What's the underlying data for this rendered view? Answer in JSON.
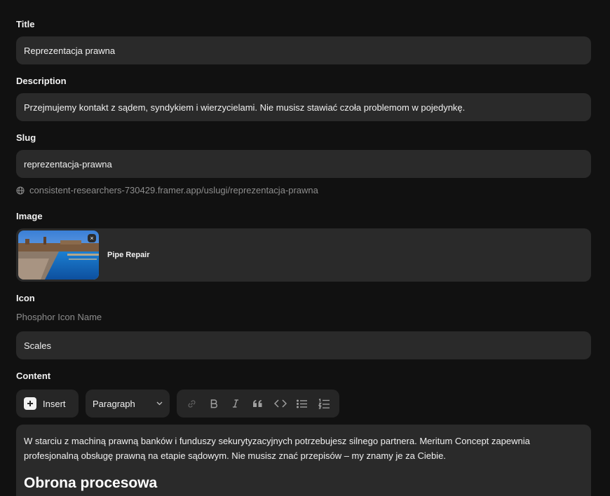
{
  "fields": {
    "title": {
      "label": "Title",
      "value": "Reprezentacja prawna"
    },
    "description": {
      "label": "Description",
      "value": "Przejmujemy kontakt z sądem, syndykiem i wierzycielami. Nie musisz stawiać czoła problemom w pojedynkę."
    },
    "slug": {
      "label": "Slug",
      "value": "reprezentacja-prawna",
      "url_hint": "consistent-researchers-730429.framer.app/uslugi/reprezentacja-prawna"
    },
    "image": {
      "label": "Image",
      "name": "Pipe Repair",
      "remove_label": "×"
    },
    "icon": {
      "label": "Icon",
      "hint": "Phosphor Icon Name",
      "value": "Scales"
    },
    "content": {
      "label": "Content"
    }
  },
  "toolbar": {
    "insert_label": "Insert",
    "block_type": "Paragraph",
    "format_icons": [
      "link-icon",
      "bold-icon",
      "italic-icon",
      "quote-icon",
      "code-icon",
      "bullet-list-icon",
      "numbered-list-icon"
    ]
  },
  "content": {
    "paragraph": "W starciu z machiną prawną banków i funduszy sekurytyzacyjnych potrzebujesz silnego partnera. Meritum Concept zapewnia profesjonalną obsługę prawną na etapie sądowym. Nie musisz znać przepisów – my znamy je za Ciebie.",
    "heading": "Obrona procesowa"
  },
  "colors": {
    "background": "#111111",
    "field": "#2a2a2a",
    "text": "#f0f0f0",
    "muted": "#8d8d8d"
  }
}
